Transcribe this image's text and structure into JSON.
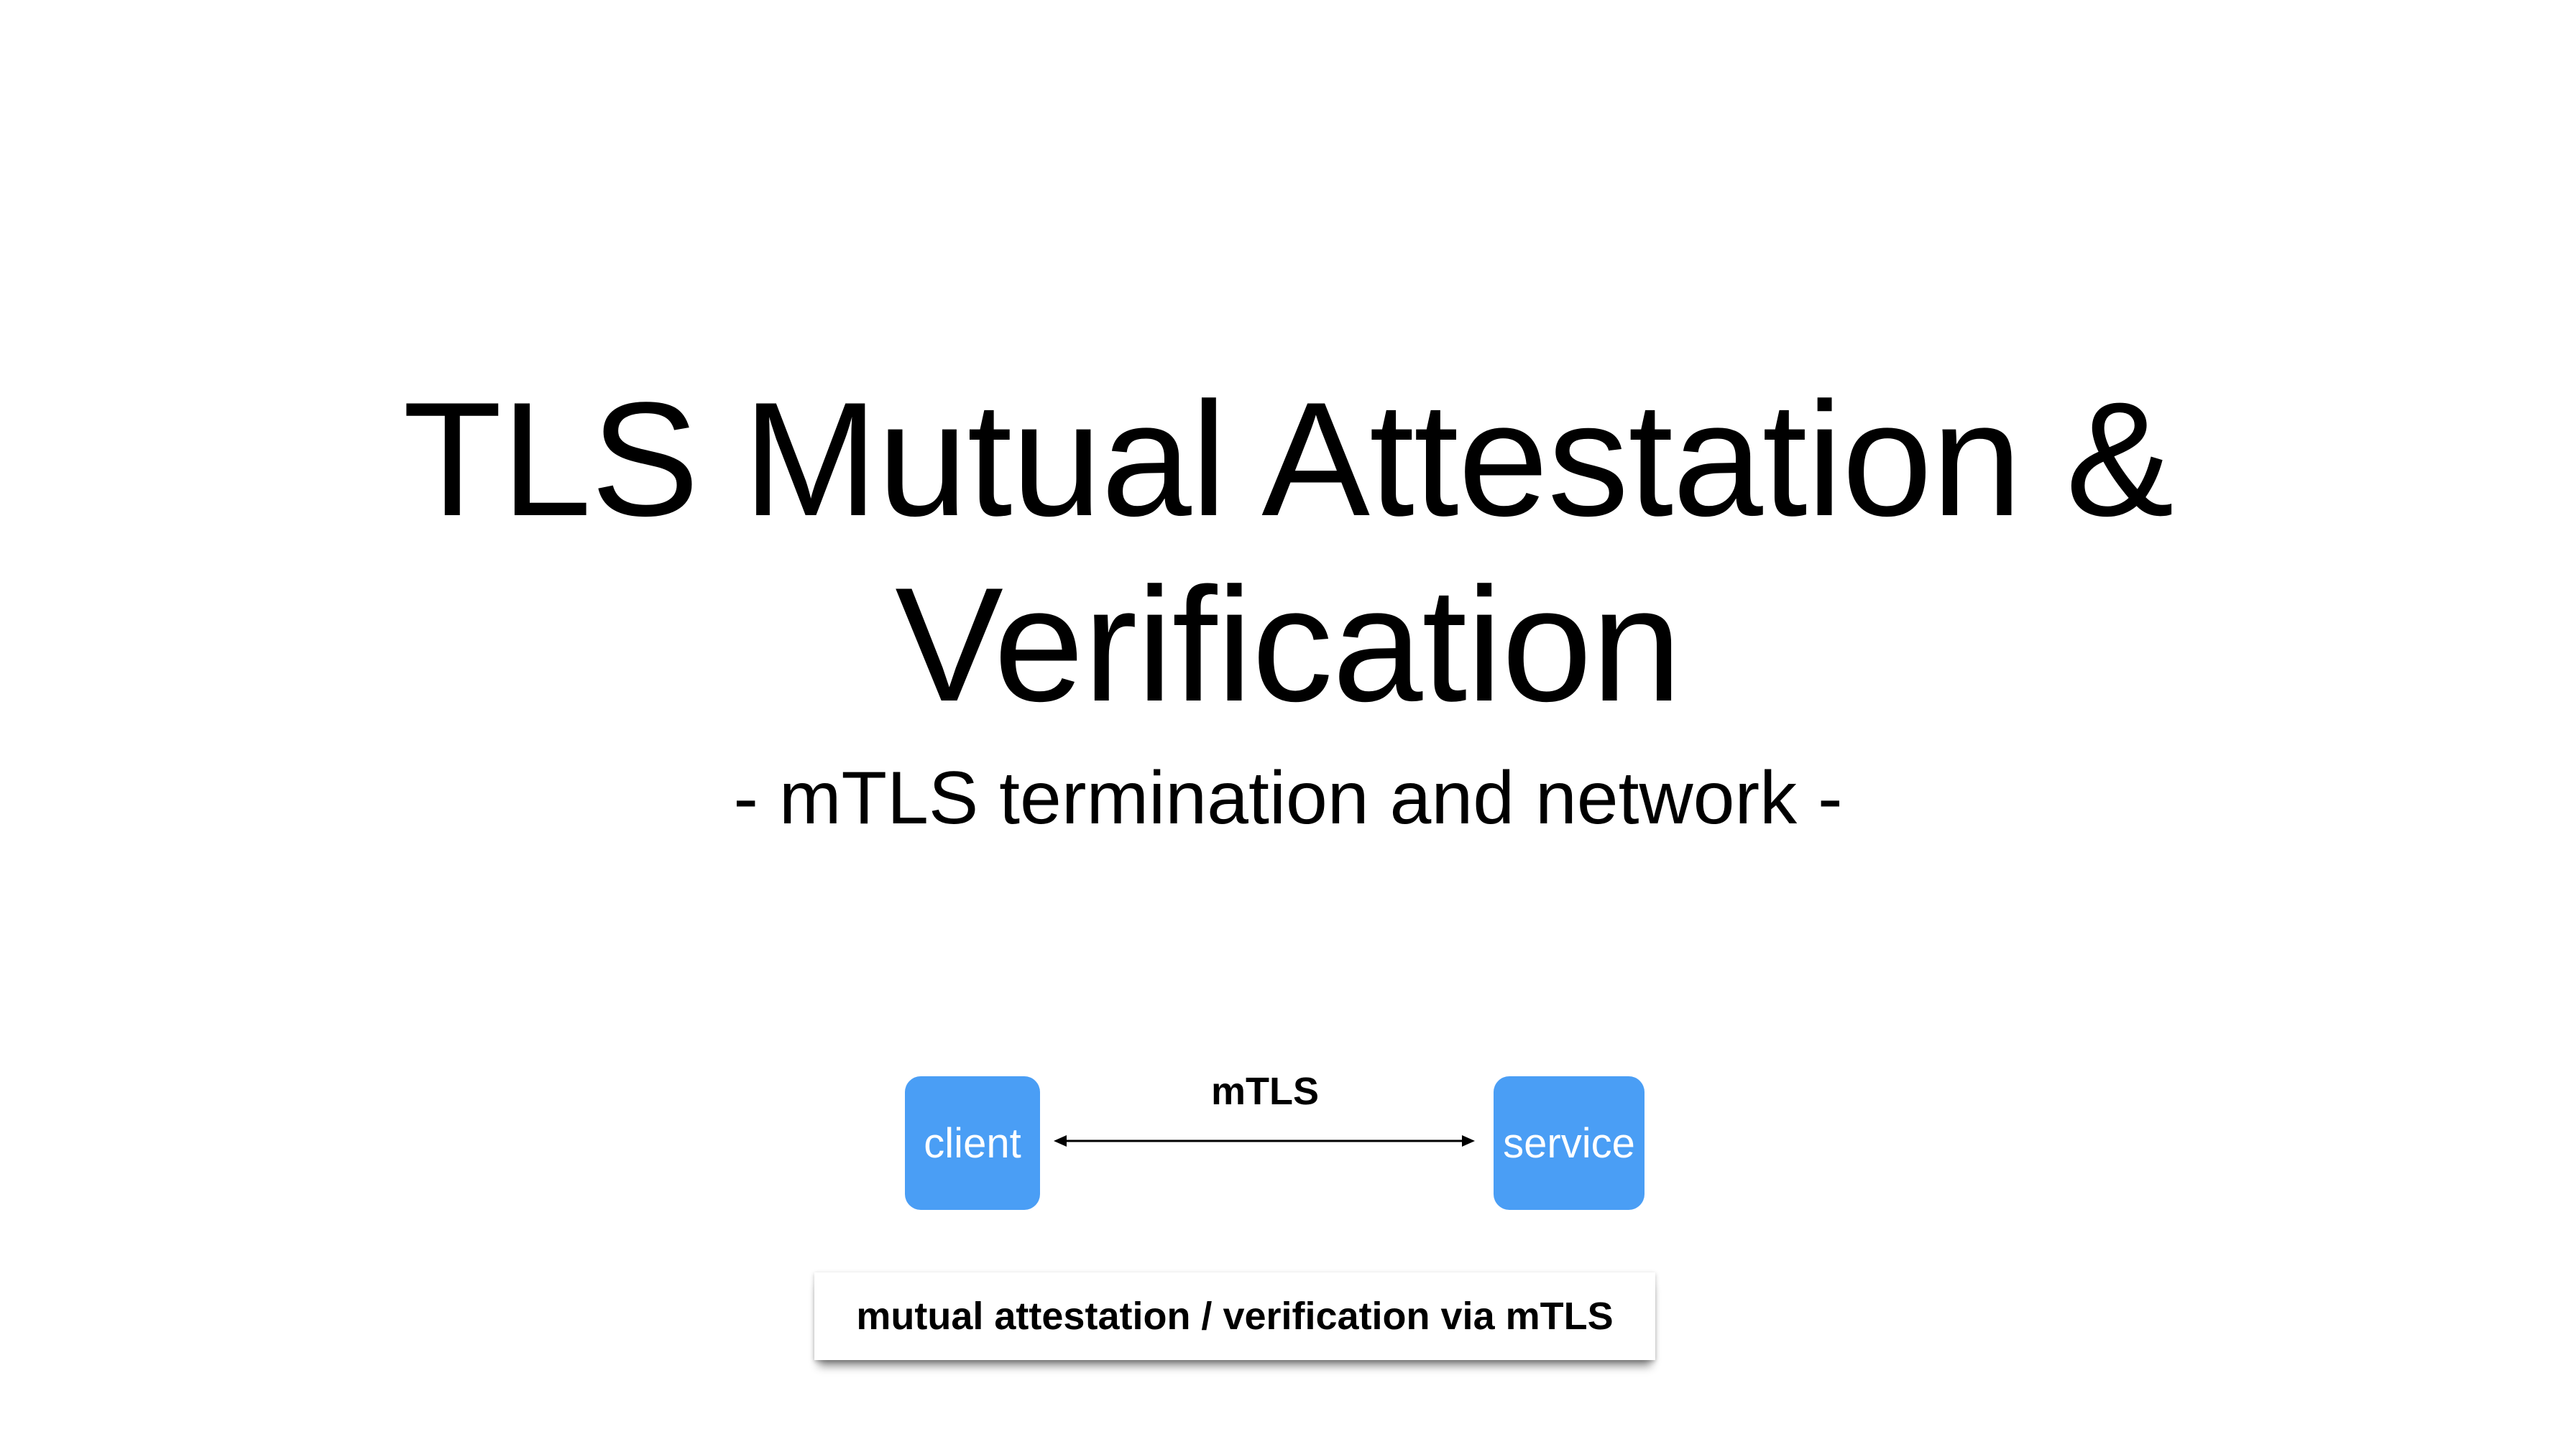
{
  "slide": {
    "title_line1": "TLS Mutual Attestation &",
    "title_line2": "Verification",
    "subtitle": "- mTLS termination and network -"
  },
  "diagram": {
    "nodes": [
      {
        "id": "client",
        "label": "client",
        "color": "#4a9ef5"
      },
      {
        "id": "service",
        "label": "service",
        "color": "#4a9ef5"
      }
    ],
    "edge": {
      "from": "client",
      "to": "service",
      "label": "mTLS",
      "bidirectional": true
    },
    "caption": "mutual attestation / verification via mTLS"
  }
}
